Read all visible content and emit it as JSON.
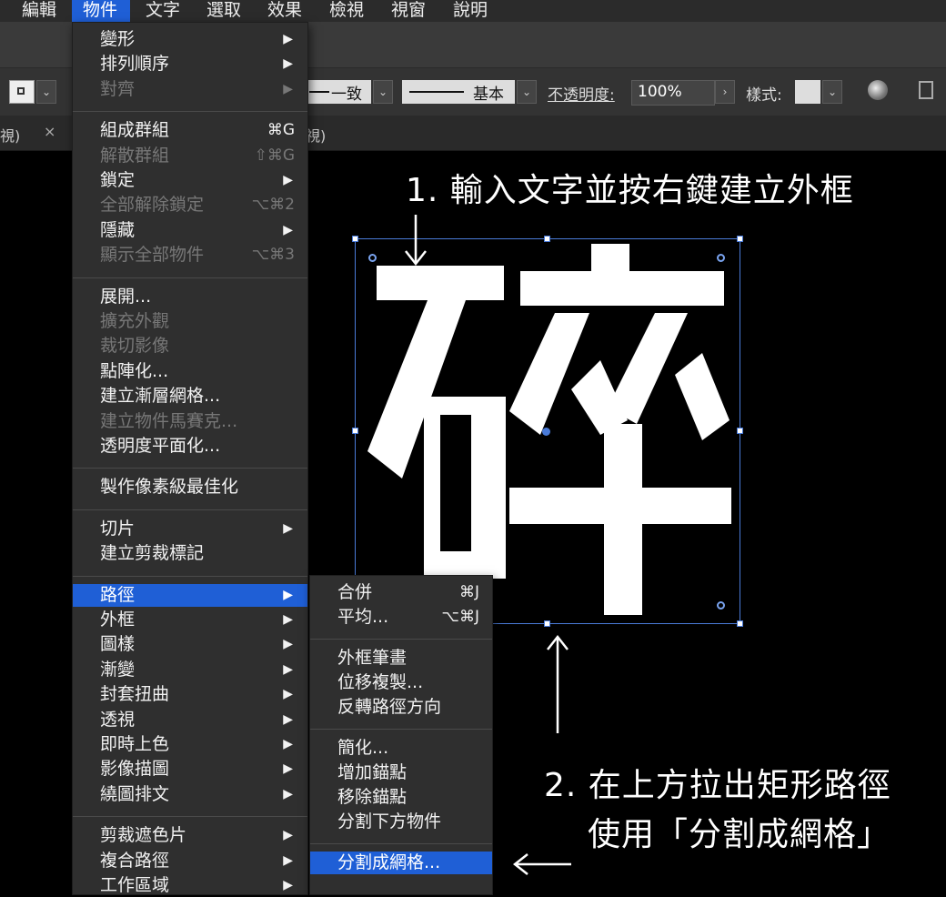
{
  "menubar": [
    "編輯",
    "物件",
    "文字",
    "選取",
    "效果",
    "檢視",
    "視窗",
    "說明"
  ],
  "controlbar": {
    "stroke_profile": "一致",
    "brush": "基本",
    "opacity_label": "不透明度:",
    "opacity_value": "100%",
    "style_label": "樣式:"
  },
  "tabs": {
    "left_fragment": "視)",
    "close": "×",
    "mid_fragment": "視)"
  },
  "object_menu": [
    {
      "label": "變形",
      "arrow": true
    },
    {
      "label": "排列順序",
      "arrow": true
    },
    {
      "label": "對齊",
      "arrow": true,
      "disabled": true
    },
    {
      "sep": true
    },
    {
      "label": "組成群組",
      "shortcut": "⌘G"
    },
    {
      "label": "解散群組",
      "shortcut": "⇧⌘G",
      "disabled": true
    },
    {
      "label": "鎖定",
      "arrow": true
    },
    {
      "label": "全部解除鎖定",
      "shortcut": "⌥⌘2",
      "disabled": true
    },
    {
      "label": "隱藏",
      "arrow": true
    },
    {
      "label": "顯示全部物件",
      "shortcut": "⌥⌘3",
      "disabled": true
    },
    {
      "sep": true
    },
    {
      "label": "展開..."
    },
    {
      "label": "擴充外觀",
      "disabled": true
    },
    {
      "label": "裁切影像",
      "disabled": true
    },
    {
      "label": "點陣化..."
    },
    {
      "label": "建立漸層網格..."
    },
    {
      "label": "建立物件馬賽克...",
      "disabled": true
    },
    {
      "label": "透明度平面化..."
    },
    {
      "sep": true
    },
    {
      "label": "製作像素級最佳化"
    },
    {
      "sep": true
    },
    {
      "label": "切片",
      "arrow": true
    },
    {
      "label": "建立剪裁標記"
    },
    {
      "sep": true
    },
    {
      "label": "路徑",
      "arrow": true,
      "selected": true
    },
    {
      "label": "外框",
      "arrow": true
    },
    {
      "label": "圖樣",
      "arrow": true
    },
    {
      "label": "漸變",
      "arrow": true
    },
    {
      "label": "封套扭曲",
      "arrow": true
    },
    {
      "label": "透視",
      "arrow": true
    },
    {
      "label": "即時上色",
      "arrow": true
    },
    {
      "label": "影像描圖",
      "arrow": true
    },
    {
      "label": "繞圖排文",
      "arrow": true
    },
    {
      "sep": true
    },
    {
      "label": "剪裁遮色片",
      "arrow": true
    },
    {
      "label": "複合路徑",
      "arrow": true
    },
    {
      "label": "工作區域",
      "arrow": true
    }
  ],
  "path_submenu": [
    {
      "label": "合併",
      "shortcut": "⌘J"
    },
    {
      "label": "平均...",
      "shortcut": "⌥⌘J"
    },
    {
      "sep": true
    },
    {
      "label": "外框筆畫"
    },
    {
      "label": "位移複製..."
    },
    {
      "label": "反轉路徑方向"
    },
    {
      "sep": true
    },
    {
      "label": "簡化..."
    },
    {
      "label": "增加錨點"
    },
    {
      "label": "移除錨點"
    },
    {
      "label": "分割下方物件"
    },
    {
      "sep": true
    },
    {
      "label": "分割成網格...",
      "selected": true
    }
  ],
  "annotations": {
    "step1": "1. 輸入文字並按右鍵建立外框",
    "step2_line1": "2. 在上方拉出矩形路徑",
    "step2_line2": "使用「分割成網格」"
  },
  "glyph": "碎",
  "colors": {
    "accent": "#1f5fd6",
    "selection": "#4a7bd8"
  }
}
